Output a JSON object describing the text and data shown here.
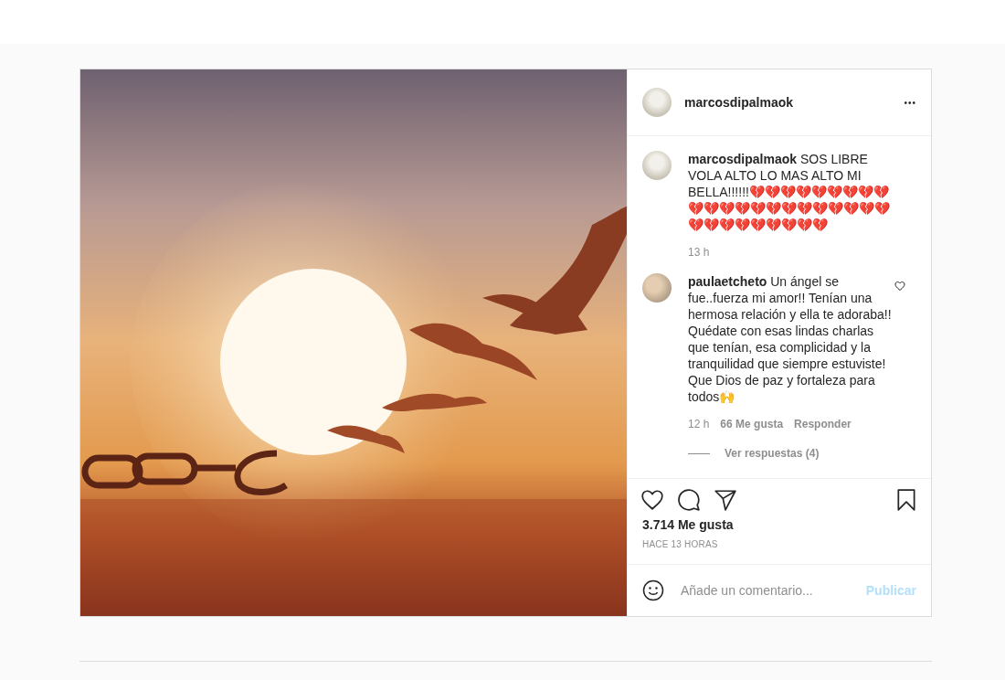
{
  "header": {
    "username": "marcosdipalmaok",
    "more": "•••"
  },
  "caption": {
    "username": "marcosdipalmaok",
    "text": "SOS LIBRE VOLA ALTO LO MAS ALTO MI BELLA!!!!!!💔💔💔💔💔💔💔💔💔💔💔💔💔💔💔💔💔💔💔💔💔💔💔💔💔💔💔💔💔💔💔",
    "time": "13 h"
  },
  "comments": [
    {
      "username": "paulaetcheto",
      "text": "Un ángel se fue..fuerza mi amor!! Tenían una hermosa relación y ella te adoraba!! Quédate con esas lindas charlas que tenían, esa complicidad y la tranquilidad que siempre estuviste! Que Dios de paz y fortaleza para todos🙌",
      "time": "12 h",
      "likes": "66 Me gusta",
      "reply": "Responder",
      "liked": false,
      "replies": "Ver respuestas (4)"
    }
  ],
  "actions": {
    "liked": false,
    "saved": false
  },
  "likes": "3.714 Me gusta",
  "date": "HACE 13 HORAS",
  "comment_box": {
    "placeholder": "Añade un comentario...",
    "publish": "Publicar",
    "disabled": true
  }
}
